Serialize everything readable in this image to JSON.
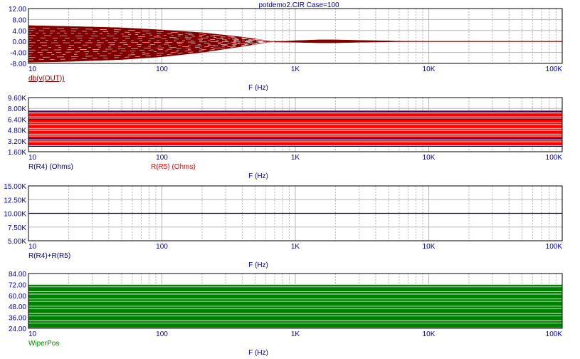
{
  "title": "potdemo2.CIR Case=100",
  "colors": {
    "axis_text": "#0000a0",
    "grid": "#b4b4b4",
    "frame": "#000000",
    "out": "#800000",
    "r4": "#000080",
    "r5": "#ff0000",
    "sum": "#000080",
    "wiper": "#008000"
  },
  "x_axis": {
    "type": "log",
    "min": 10,
    "max": 100000,
    "ticks": [
      10,
      100,
      1000,
      10000,
      100000
    ],
    "tick_labels": [
      "10",
      "100",
      "1K",
      "10K",
      "100K"
    ],
    "xlabel": "F (Hz)"
  },
  "chart_data": [
    {
      "type": "line",
      "id": "out",
      "ylim": [
        -8,
        12
      ],
      "yticks": [
        -8,
        -4,
        0,
        4,
        8,
        12
      ],
      "ytick_labels": [
        "-8.00",
        "-4.00",
        "0.00",
        "4.00",
        "8.00",
        "12.00"
      ],
      "xlabel": "F (Hz)",
      "legend": [
        {
          "text": "db(v(OUT))",
          "color": "#800000"
        }
      ],
      "series": [
        {
          "name": "db(v(OUT))",
          "color": "#800000",
          "style": "envelope",
          "x": [
            10,
            20,
            50,
            100,
            200,
            400,
            600,
            700,
            1000,
            1500,
            2000,
            3000,
            5000,
            6000,
            10000,
            100000
          ],
          "upper": [
            5.8,
            5.5,
            5.0,
            4.2,
            3.2,
            1.6,
            0.4,
            -0.2,
            0.3,
            0.6,
            0.6,
            0.4,
            0.2,
            0.05,
            0.0,
            0.0
          ],
          "lower": [
            -7.6,
            -7.3,
            -6.6,
            -5.6,
            -4.0,
            -1.8,
            -0.5,
            -0.2,
            -0.3,
            -0.5,
            -0.5,
            -0.3,
            -0.15,
            -0.05,
            0.0,
            0.0
          ]
        }
      ]
    },
    {
      "type": "line",
      "id": "resist",
      "ylim": [
        1600,
        9600
      ],
      "yticks": [
        1600,
        3200,
        4800,
        6400,
        8000,
        9600
      ],
      "ytick_labels": [
        "1.60K",
        "3.20K",
        "4.80K",
        "6.40K",
        "8.00K",
        "9.60K"
      ],
      "xlabel": "F (Hz)",
      "legend": [
        {
          "text": "R(R4) (Ohms)",
          "color": "#000080"
        },
        {
          "text": "R(R5) (Ohms)",
          "color": "#ff0000"
        }
      ],
      "series": [
        {
          "name": "R(R5) (Ohms)",
          "color": "#ff0000",
          "style": "band",
          "low": 2500,
          "high": 7600
        },
        {
          "name": "R(R4) (Ohms)",
          "color": "#000080",
          "style": "lines",
          "values": [
            2400,
            3600,
            6400,
            7600
          ]
        }
      ]
    },
    {
      "type": "line",
      "id": "sum",
      "ylim": [
        5000,
        15000
      ],
      "yticks": [
        5000,
        7500,
        10000,
        12500,
        15000
      ],
      "ytick_labels": [
        "5.00K",
        "7.50K",
        "10.00K",
        "12.50K",
        "15.00K"
      ],
      "xlabel": "F (Hz)",
      "legend": [
        {
          "text": "R(R4)+R(R5)",
          "color": "#000080"
        }
      ],
      "series": [
        {
          "name": "R(R4)+R(R5)",
          "color": "#000080",
          "style": "lines",
          "values": [
            10000
          ]
        }
      ]
    },
    {
      "type": "line",
      "id": "wiper",
      "ylim": [
        24,
        84
      ],
      "yticks": [
        24,
        36,
        48,
        60,
        72,
        84
      ],
      "ytick_labels": [
        "24.00",
        "36.00",
        "48.00",
        "60.00",
        "72.00",
        "84.00"
      ],
      "xlabel": "F (Hz)",
      "legend": [
        {
          "text": "WiperPos",
          "color": "#008000"
        }
      ],
      "series": [
        {
          "name": "WiperPos",
          "color": "#008000",
          "style": "band",
          "low": 24.5,
          "high": 72
        }
      ]
    }
  ]
}
